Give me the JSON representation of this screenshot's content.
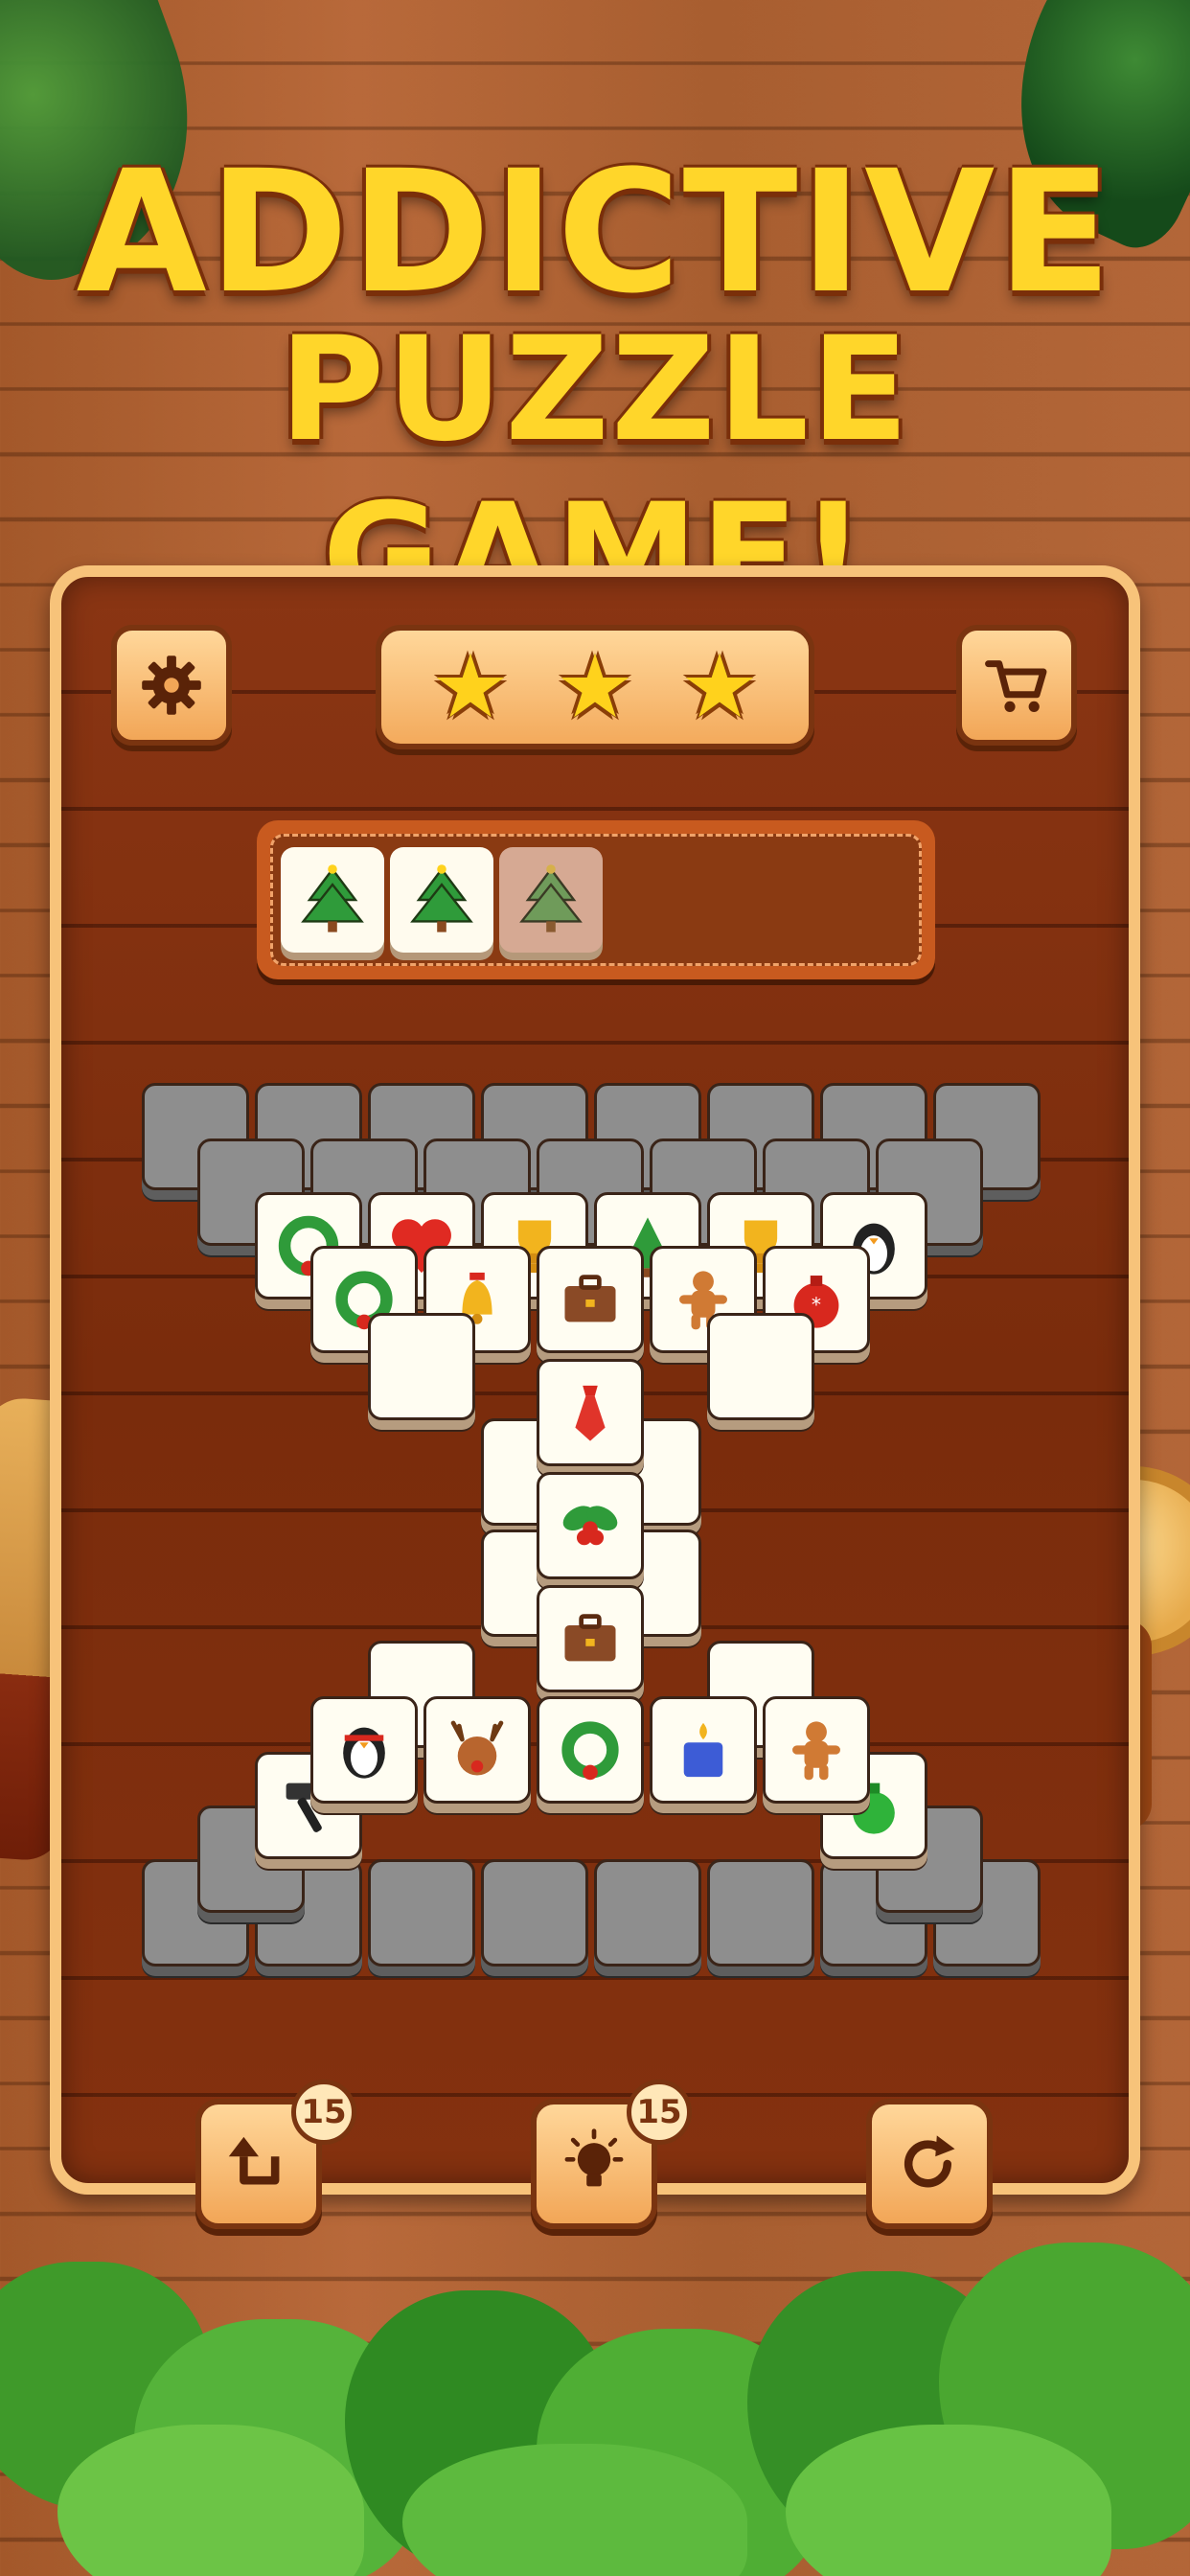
{
  "headline": {
    "line1": "ADDICTIVE",
    "line2": "PUZZLE GAME!"
  },
  "top_bar": {
    "settings_icon": "gear-icon",
    "stars": [
      "★",
      "★",
      "★"
    ],
    "shop_icon": "cart-icon"
  },
  "tray": {
    "slots": [
      "tree",
      "tree",
      "tree"
    ]
  },
  "controls": {
    "undo": {
      "icon": "undo-icon",
      "count": "15"
    },
    "hint": {
      "icon": "lightbulb-icon",
      "count": "15"
    },
    "shuffle": {
      "icon": "shuffle-icon"
    }
  },
  "colors": {
    "headline": "#ffd62a",
    "board": "#7a2c0c",
    "button": "#f2a657"
  }
}
